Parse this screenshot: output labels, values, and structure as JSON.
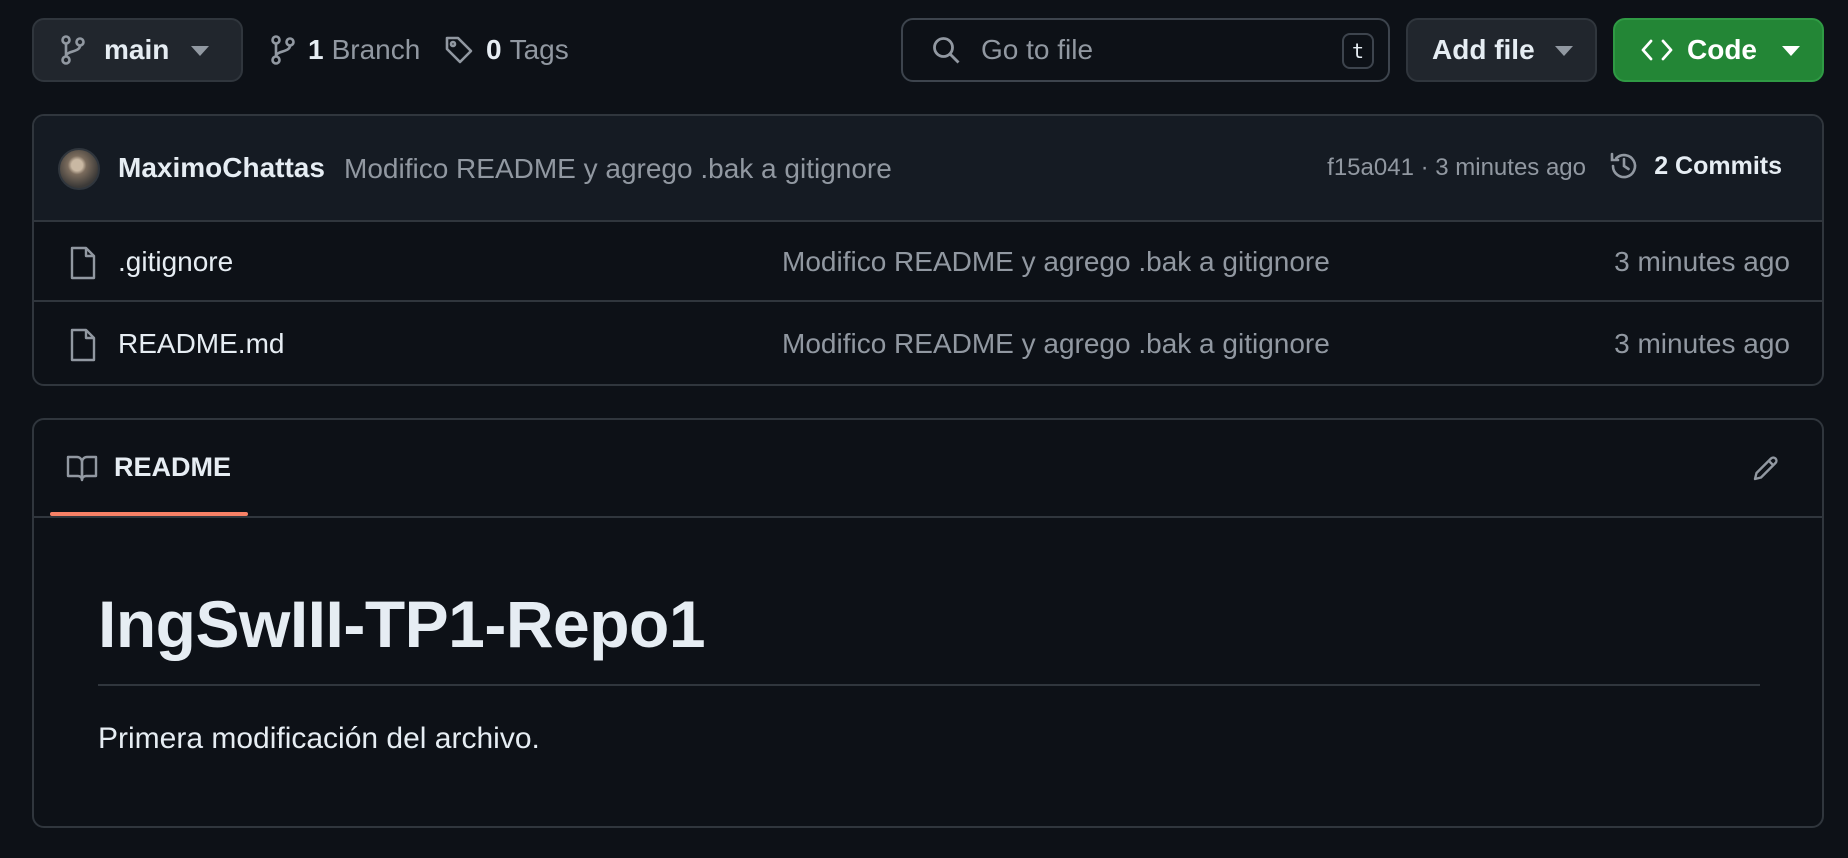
{
  "toolbar": {
    "branch": "main",
    "branches_count": "1",
    "branches_label": "Branch",
    "tags_count": "0",
    "tags_label": "Tags",
    "search_placeholder": "Go to file",
    "search_shortcut": "t",
    "add_file_label": "Add file",
    "code_label": "Code"
  },
  "latest_commit": {
    "author": "MaximoChattas",
    "message": "Modifico README y agrego .bak a gitignore",
    "meta": "f15a041 · 3 minutes ago",
    "commits_label": "2 Commits"
  },
  "files": [
    {
      "name": ".gitignore",
      "message": "Modifico README y agrego .bak a gitignore",
      "date": "3 minutes ago",
      "icon": "file-icon"
    },
    {
      "name": "README.md",
      "message": "Modifico README y agrego .bak a gitignore",
      "date": "3 minutes ago",
      "icon": "file-icon"
    }
  ],
  "readme": {
    "tab_label": "README",
    "title": "IngSwIII-TP1-Repo1",
    "body": "Primera modificación del archivo."
  },
  "colors": {
    "background": "#0d1117",
    "code_button": "#238636",
    "tab_underline": "#f78166"
  }
}
